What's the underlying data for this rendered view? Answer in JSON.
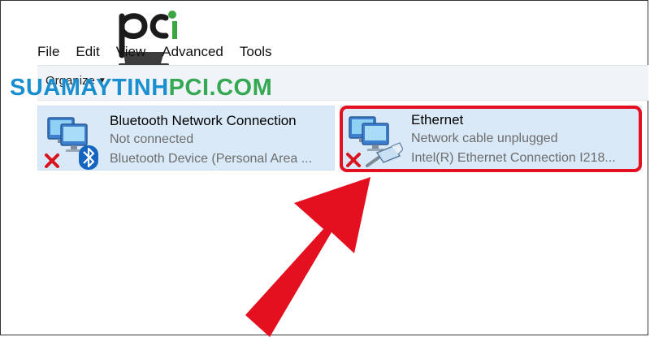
{
  "menu": {
    "items": [
      "File",
      "Edit",
      "View",
      "Advanced",
      "Tools"
    ]
  },
  "toolbar": {
    "organize_label": "Organize",
    "organize_caret": "▼"
  },
  "watermark": {
    "text_part1": "SUAMAYTINH",
    "text_part2": "PCI.COM",
    "logo_text": "pci"
  },
  "connections": [
    {
      "name": "Bluetooth Network Connection",
      "status": "Not connected",
      "device": "Bluetooth Device (Personal Area ...",
      "icon": "network-bluetooth-icon",
      "badge": "red-x-icon"
    },
    {
      "name": "Ethernet",
      "status": "Network cable unplugged",
      "device": "Intel(R) Ethernet Connection I218...",
      "icon": "network-ethernet-icon",
      "badge": "red-x-icon"
    }
  ],
  "annotation": {
    "highlight_color": "#e4101f",
    "arrow_color": "#e4101f"
  },
  "colors": {
    "selection_bg": "#d9e9f8",
    "watermark_blue": "#1a8fd0",
    "watermark_green": "#34a853"
  }
}
